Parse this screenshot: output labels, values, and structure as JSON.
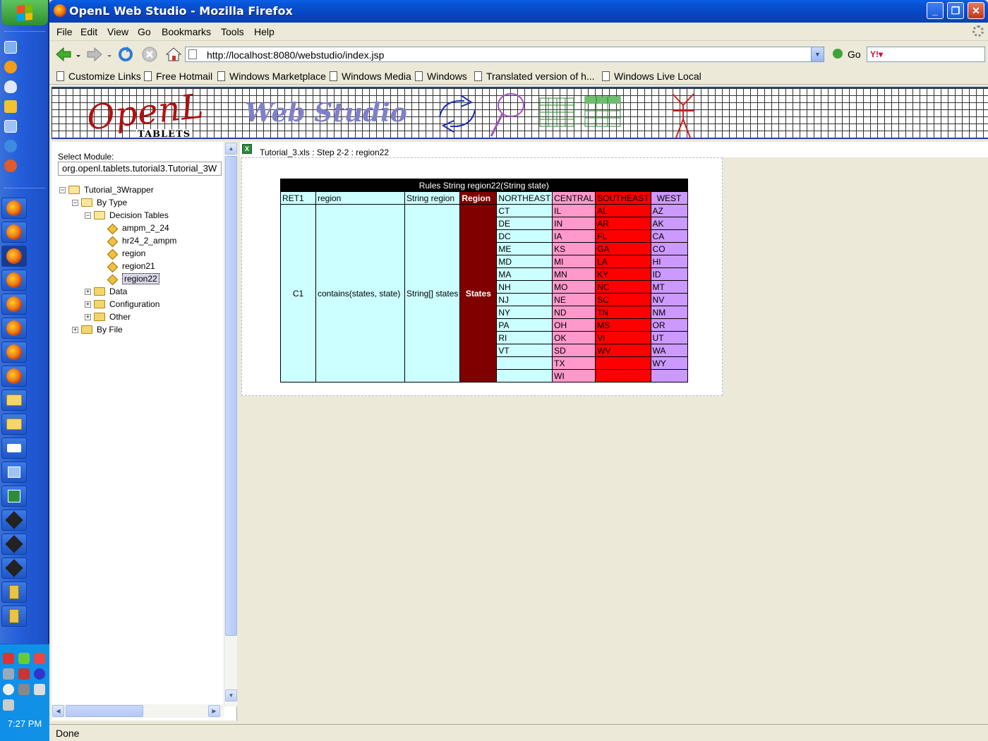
{
  "window": {
    "title": "OpenL Web Studio - Mozilla Firefox"
  },
  "menu": [
    "File",
    "Edit",
    "View",
    "Go",
    "Bookmarks",
    "Tools",
    "Help"
  ],
  "navigation": {
    "url": "http://localhost:8080/webstudio/index.jsp",
    "go_label": "Go",
    "search_value": ""
  },
  "bookmarks": [
    "Customize Links",
    "Free Hotmail",
    "Windows Marketplace",
    "Windows Media",
    "Windows",
    "Translated version of h...",
    "Windows Live Local"
  ],
  "banner": {
    "logo": "OpenL",
    "logo_sub": "TABLETS",
    "product": "Web Studio"
  },
  "left_panel": {
    "select_label": "Select Module:",
    "module_value": "org.openl.tablets.tutorial3.Tutorial_3W",
    "tree": {
      "root": "Tutorial_3Wrapper",
      "by_type": "By Type",
      "decision_tables": "Decision Tables",
      "tables": [
        "ampm_2_24",
        "hr24_2_ampm",
        "region",
        "region21",
        "region22"
      ],
      "selected_table": "region22",
      "data": "Data",
      "configuration": "Configuration",
      "other": "Other",
      "by_file": "By File"
    }
  },
  "content": {
    "breadcrumb": "Tutorial_3.xls : Step 2-2 : region22",
    "table": {
      "title": "Rules String region22(String state)",
      "headers": [
        "RET1",
        "region",
        "String region",
        "Region",
        "NORTHEAST",
        "CENTRAL",
        "SOUTHEAST",
        "WEST"
      ],
      "rule_id": "C1",
      "condition": "contains(states, state)",
      "param": "String[] states",
      "param_label": "States",
      "northeast": [
        "CT",
        "DE",
        "DC",
        "ME",
        "MD",
        "MA",
        "NH",
        "NJ",
        "NY",
        "PA",
        "RI",
        "VT",
        "",
        ""
      ],
      "central": [
        "IL",
        "IN",
        "IA",
        "KS",
        "MI",
        "MN",
        "MO",
        "NE",
        "ND",
        "OH",
        "OK",
        "SD",
        "TX",
        "WI"
      ],
      "southeast": [
        "AL",
        "AR",
        "FL",
        "GA",
        "LA",
        "KY",
        "NC",
        "SC",
        "TN",
        "MS",
        "VI",
        "WV",
        "",
        ""
      ],
      "west": [
        "AZ",
        "AK",
        "CA",
        "CO",
        "HI",
        "ID",
        "MT",
        "NV",
        "NM",
        "OR",
        "UT",
        "WA",
        "WY",
        ""
      ]
    },
    "colors": {
      "northeast": "#ccffff",
      "central": "#ff99cc",
      "southeast": "#ff0000",
      "west": "#cc99ff",
      "region_header": "#800000"
    }
  },
  "status": "Done",
  "taskbar": {
    "clock": "7:27 PM"
  }
}
